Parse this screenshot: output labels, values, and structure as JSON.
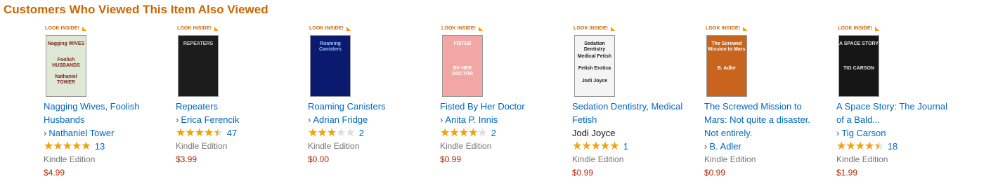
{
  "header": {
    "title": "Customers Who Viewed This Item Also Viewed"
  },
  "colors": {
    "header": "#cc6600",
    "link": "#0066c0",
    "price": "#b12704",
    "star": "#f4a200"
  },
  "look_inside_label": "LOOK INSIDE!",
  "items": [
    {
      "title": "Nagging Wives, Foolish Husbands",
      "author": "Nathaniel Tower",
      "author_linked": true,
      "rating": 5,
      "review_count": "13",
      "format": "Kindle Edition",
      "price": "$4.99",
      "cover": {
        "bg": "#dfe7d6",
        "text": [
          "Nagging WIVES",
          "Foolish HUSBANDS",
          "Nathaniel TOWER"
        ],
        "text_color": "#7a2a1a"
      }
    },
    {
      "title": "Repeaters",
      "author": "Erica Ferencik",
      "author_linked": true,
      "rating": 4.5,
      "review_count": "47",
      "format": "Kindle Edition",
      "price": "$3.99",
      "cover": {
        "bg": "#1c1c1c",
        "text": [
          "REPEATERS"
        ],
        "text_color": "#cccccc"
      }
    },
    {
      "title": "Roaming Canisters",
      "author": "Adrian Fridge",
      "author_linked": true,
      "rating": 3,
      "review_count": "2",
      "format": "Kindle Edition",
      "price": "$0.00",
      "cover": {
        "bg": "#0a1a6e",
        "text": [
          "Roaming Canisters"
        ],
        "text_color": "#9fc0ff"
      }
    },
    {
      "title": "Fisted By Her Doctor",
      "author": "Anita P. Innis",
      "author_linked": true,
      "rating": 4,
      "review_count": "2",
      "format": "Kindle Edition",
      "price": "$0.99",
      "cover": {
        "bg": "#f2a7a4",
        "text": [
          "FISTED",
          "BY HER DOCTOR"
        ],
        "text_color": "#ffffff"
      }
    },
    {
      "title": "Sedation Dentistry, Medical Fetish",
      "author": "Jodi Joyce",
      "author_linked": false,
      "rating": 5,
      "review_count": "1",
      "format": "Kindle Edition",
      "price": "$0.99",
      "cover": {
        "bg": "#f4f4f4",
        "text": [
          "Sedation Dentistry",
          "Medical Fetish",
          "Fetish Erotica",
          "Jodi Joyce"
        ],
        "text_color": "#222222"
      }
    },
    {
      "title": "The Screwed Mission to Mars: Not quite a disaster. Not entirely.",
      "author": "B. Adler",
      "author_linked": true,
      "rating": null,
      "review_count": "",
      "format": "Kindle Edition",
      "price": "$0.99",
      "cover": {
        "bg": "#c8641e",
        "text": [
          "The Screwed Mission to Mars",
          "B. Adler"
        ],
        "text_color": "#ffffff"
      }
    },
    {
      "title": "A Space Story: The Journal of a Bald...",
      "author": "Tig Carson",
      "author_linked": true,
      "rating": 4.5,
      "review_count": "18",
      "format": "Kindle Edition",
      "price": "$1.99",
      "cover": {
        "bg": "#161616",
        "text": [
          "A SPACE STORY",
          "TIG CARSON"
        ],
        "text_color": "#e0e0e0"
      }
    }
  ]
}
